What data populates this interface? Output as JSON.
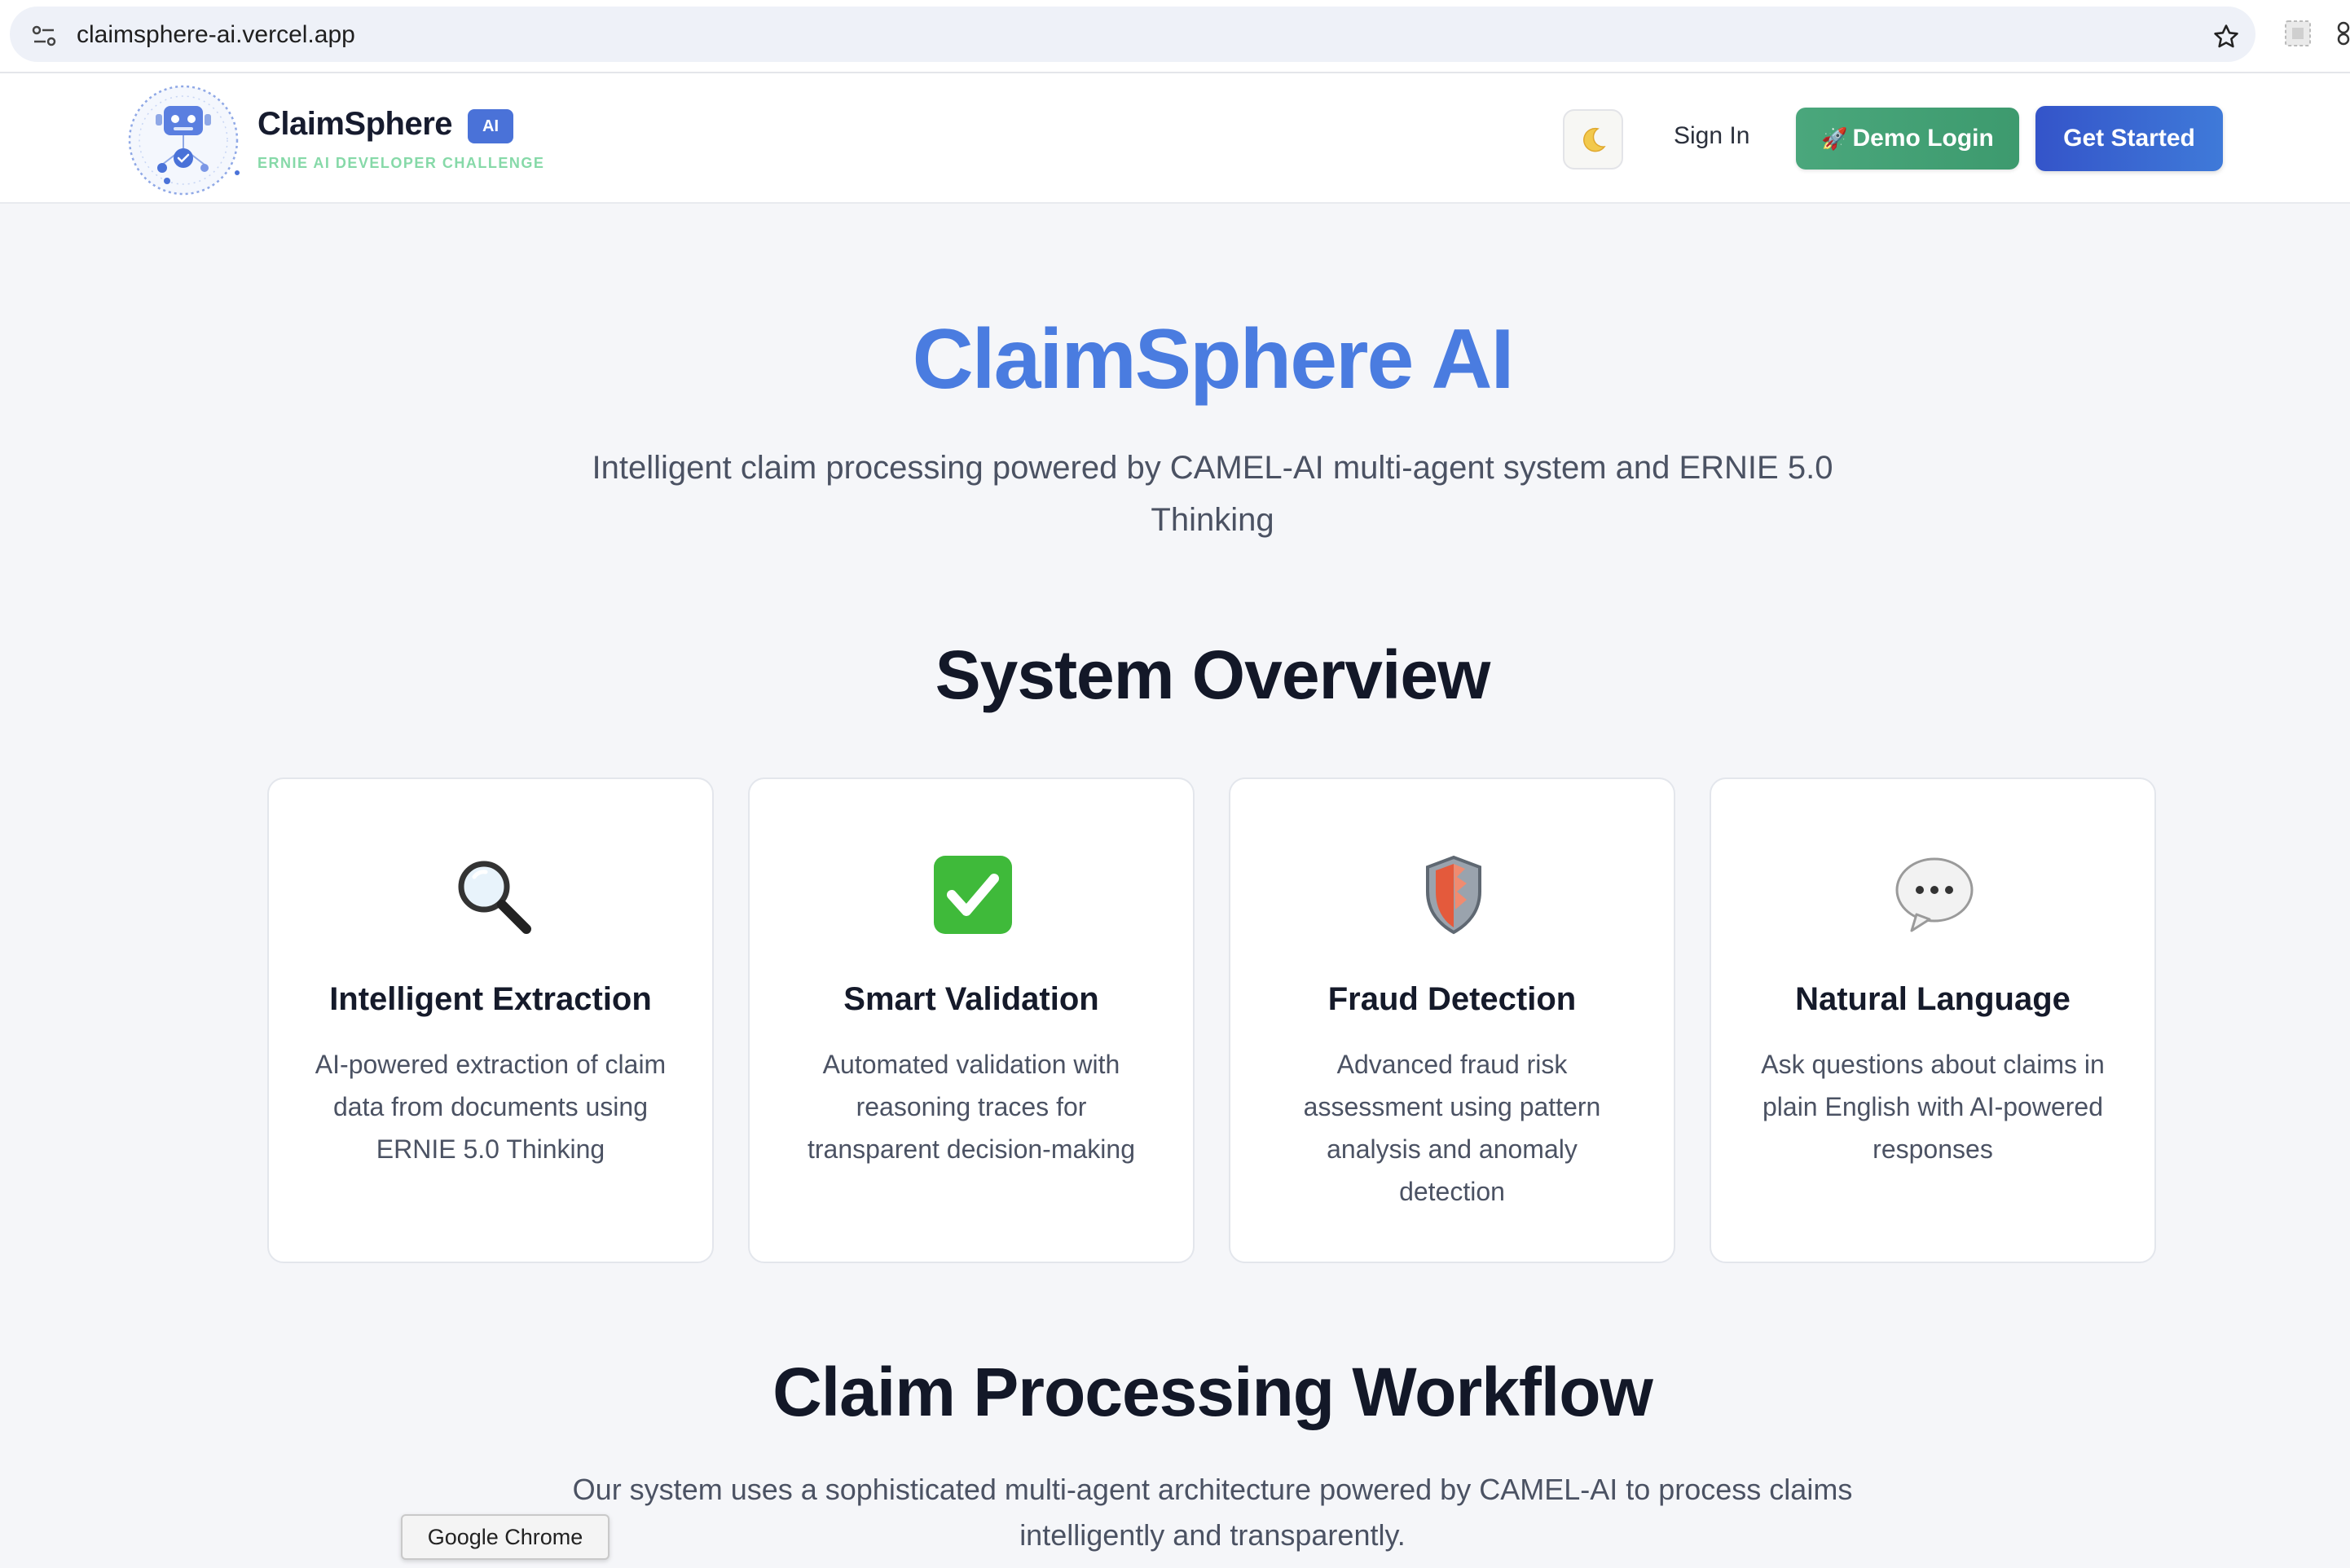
{
  "browser": {
    "url": "claimsphere-ai.vercel.app"
  },
  "header": {
    "brand_name": "ClaimSphere",
    "brand_tag": "AI",
    "tagline": "ERNIE AI DEVELOPER CHALLENGE",
    "theme_toggle_icon": "moon-icon",
    "sign_in_label": "Sign In",
    "demo_login_icon": "rocket-icon",
    "demo_login_label": "Demo Login",
    "get_started_label": "Get Started"
  },
  "hero": {
    "title": "ClaimSphere AI",
    "subtitle": "Intelligent claim processing powered by CAMEL-AI multi-agent system and ERNIE 5.0 Thinking"
  },
  "overview": {
    "title": "System Overview",
    "cards": [
      {
        "icon": "magnifier-icon",
        "title": "Intelligent Extraction",
        "description": "AI-powered extraction of claim data from documents using ERNIE 5.0 Thinking"
      },
      {
        "icon": "check-mark-icon",
        "title": "Smart Validation",
        "description": "Automated validation with reasoning traces for transparent decision-making"
      },
      {
        "icon": "shield-icon",
        "title": "Fraud Detection",
        "description": "Advanced fraud risk assessment using pattern analysis and anomaly detection"
      },
      {
        "icon": "speech-bubble-icon",
        "title": "Natural Language",
        "description": "Ask questions about claims in plain English with AI-powered responses"
      }
    ]
  },
  "workflow": {
    "title": "Claim Processing Workflow",
    "description": "Our system uses a sophisticated multi-agent architecture powered by CAMEL-AI to process claims intelligently and transparently."
  },
  "tooltip": {
    "text": "Google Chrome"
  },
  "colors": {
    "accent_blue": "#4a7ce0",
    "demo_green": "#4aa77c",
    "cta_blue": "#3454c9",
    "tagline_green": "#86d9a8"
  }
}
